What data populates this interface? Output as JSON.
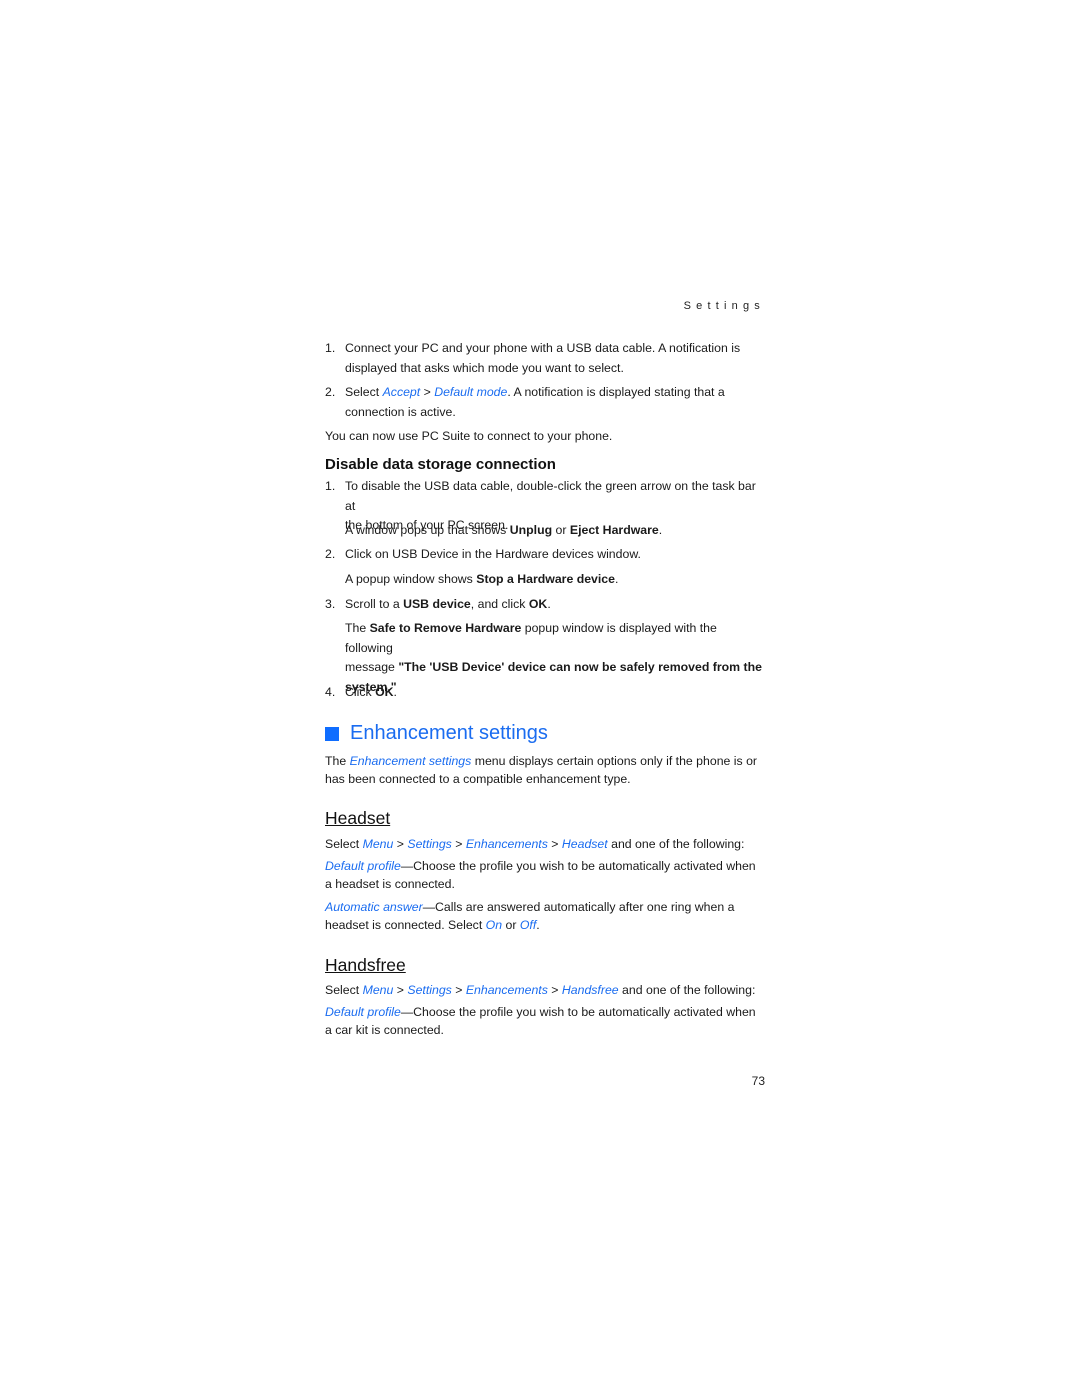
{
  "running_head": "Settings",
  "page_number": "73",
  "connect_steps": [
    {
      "num": "1.",
      "line1": "Connect your PC and your phone with a USB data cable. A notification is",
      "line2": "displayed that asks which mode you want to select."
    },
    {
      "num": "2.",
      "pre": "Select ",
      "link1": "Accept",
      "sep": " > ",
      "link2": "Default mode",
      "post": ". A notification is displayed stating that a",
      "line2": "connection is active."
    }
  ],
  "pc_suite_note": "You can now use PC Suite to connect to your phone.",
  "disable_section": {
    "title": "Disable data storage connection",
    "step1": {
      "num": "1.",
      "line1": "To disable the USB data cable, double-click the green arrow on the task bar at",
      "line2": "the bottom of your PC screen."
    },
    "step1_note": {
      "pre": "A window pops up that shows ",
      "b1": "Unplug",
      "mid": " or ",
      "b2": "Eject Hardware",
      "post": "."
    },
    "step2": {
      "num": "2.",
      "text": "Click on USB Device in the Hardware devices window."
    },
    "step2_note": {
      "pre": "A popup window shows ",
      "b1": "Stop a Hardware device",
      "post": "."
    },
    "step3": {
      "num": "3.",
      "pre": "Scroll to a ",
      "b1": "USB device",
      "mid": ", and click ",
      "b2": "OK",
      "post": "."
    },
    "step3_note": {
      "pre": "The ",
      "b1": "Safe to Remove Hardware",
      "post": " popup window is displayed with the following",
      "line2_pre": "message ",
      "line2_b": "\"The 'USB Device' device can now be safely removed from the",
      "line3_b": "system.\""
    },
    "step4": {
      "num": "4.",
      "pre": "Click ",
      "b1": "OK",
      "post": "."
    }
  },
  "enhancement": {
    "title": "Enhancement settings",
    "intro_pre": "The ",
    "intro_link": "Enhancement settings",
    "intro_post": " menu displays certain options only if the phone is or",
    "intro_line2": "has been connected to a compatible enhancement type."
  },
  "headset": {
    "title": "Headset",
    "path": {
      "pre": "Select ",
      "items": [
        "Menu",
        "Settings",
        "Enhancements",
        "Headset"
      ],
      "sep": " > ",
      "post": " and one of the following:"
    },
    "option1": {
      "link": "Default profile",
      "text": "—Choose the profile you wish to be automatically activated when",
      "line2": "a headset is connected."
    },
    "option2": {
      "link": "Automatic answer",
      "text": "—Calls are answered automatically after one ring when a",
      "line2_pre": "headset is connected. Select ",
      "on": "On",
      "or": " or ",
      "off": "Off",
      "end": "."
    }
  },
  "handsfree": {
    "title": "Handsfree",
    "path": {
      "pre": "Select ",
      "items": [
        "Menu",
        "Settings",
        "Enhancements",
        "Handsfree"
      ],
      "sep": " > ",
      "post": " and one of the following:"
    },
    "option1": {
      "link": "Default profile",
      "text": "—Choose the profile you wish to be automatically activated when",
      "line2": "a car kit is connected."
    }
  },
  "colors": {
    "accent": "#1a6cf0",
    "marker": "#0f6dff",
    "text": "#1a1a1a"
  }
}
